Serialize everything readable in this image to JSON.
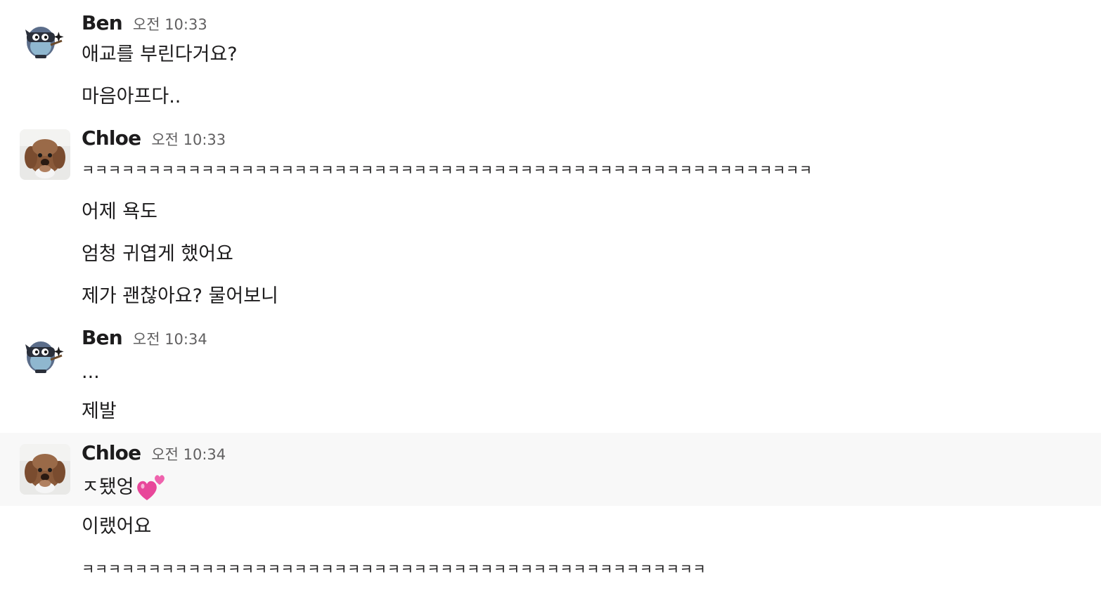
{
  "messages": [
    {
      "sender": "Ben",
      "avatar": "ninja-mascot-avatar",
      "time": "오전 10:33",
      "lines": [
        "애교를 부린다거요?",
        "마음아프다.."
      ]
    },
    {
      "sender": "Chloe",
      "avatar": "dog-avatar",
      "time": "오전 10:33",
      "lines": [
        "ㅋㅋㅋㅋㅋㅋㅋㅋㅋㅋㅋㅋㅋㅋㅋㅋㅋㅋㅋㅋㅋㅋㅋㅋㅋㅋㅋㅋㅋㅋㅋㅋㅋㅋㅋㅋㅋㅋㅋㅋㅋㅋㅋㅋㅋㅋㅋㅋㅋㅋㅋㅋㅋㅋㅋ",
        "어제 욕도",
        "엄청 귀엽게 했어요",
        "제가 괜찮아요? 물어보니"
      ]
    },
    {
      "sender": "Ben",
      "avatar": "ninja-mascot-avatar",
      "time": "오전 10:34",
      "lines": [
        "...",
        "제발"
      ]
    },
    {
      "sender": "Chloe",
      "avatar": "dog-avatar",
      "time": "오전 10:34",
      "lines": [
        "ㅈ됐엉",
        "이랬어요",
        "ㅋㅋㅋㅋㅋㅋㅋㅋㅋㅋㅋㅋㅋㅋㅋㅋㅋㅋㅋㅋㅋㅋㅋㅋㅋㅋㅋㅋㅋㅋㅋㅋㅋㅋㅋㅋㅋㅋㅋㅋㅋㅋㅋㅋㅋㅋㅋ"
      ],
      "emoji": "two-hearts-emoji"
    }
  ],
  "colors": {
    "text": "#1d1c1d",
    "timestamp": "#616061",
    "hover_background": "#f8f8f8",
    "heart": "#e8479a"
  }
}
